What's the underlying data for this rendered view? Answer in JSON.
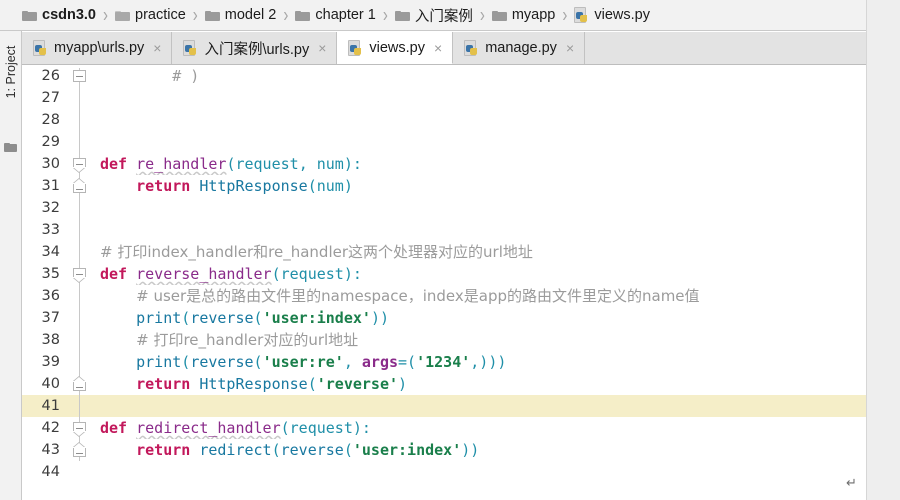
{
  "window": {
    "right_strip_color": "#eeeeee"
  },
  "breadcrumb": {
    "name": "project-breadcrumb",
    "separator": "›",
    "items": [
      {
        "label": "csdn3.0",
        "icon": "folder-icon",
        "bold": true
      },
      {
        "label": "practice",
        "icon": "folder-open-icon",
        "bold": false
      },
      {
        "label": "model 2",
        "icon": "folder-icon",
        "bold": false
      },
      {
        "label": "chapter 1",
        "icon": "folder-icon",
        "bold": false
      },
      {
        "label": "入门案例",
        "icon": "folder-icon",
        "bold": false
      },
      {
        "label": "myapp",
        "icon": "folder-icon",
        "bold": false
      },
      {
        "label": "views.py",
        "icon": "python-file-icon",
        "bold": false
      }
    ]
  },
  "tool_window": {
    "label": "1: Project",
    "icon": "folder-icon"
  },
  "tabs": [
    {
      "label": "myapp\\urls.py",
      "icon": "python-file-icon",
      "close": "×",
      "active": false
    },
    {
      "label": "入门案例\\urls.py",
      "icon": "python-file-icon",
      "close": "×",
      "active": false
    },
    {
      "label": "views.py",
      "icon": "python-file-icon",
      "close": "×",
      "active": true
    },
    {
      "label": "manage.py",
      "icon": "python-file-icon",
      "close": "×",
      "active": false
    }
  ],
  "editor": {
    "current_line": 41,
    "current_line_color": "#f5eec8",
    "end_of_file_glyph": "↵",
    "first_line": 26,
    "last_line": 44,
    "lines": [
      {
        "num": "26",
        "fold": "collapsed-box",
        "text": "        # )"
      },
      {
        "num": "27",
        "fold": "line",
        "text": ""
      },
      {
        "num": "28",
        "fold": "line",
        "text": ""
      },
      {
        "num": "29",
        "fold": "line",
        "text": ""
      },
      {
        "num": "30",
        "fold": "block-start",
        "text": "def re_handler(request, num):"
      },
      {
        "num": "31",
        "fold": "block-end",
        "text": "    return HttpResponse(num)"
      },
      {
        "num": "32",
        "fold": "line",
        "text": ""
      },
      {
        "num": "33",
        "fold": "line",
        "text": ""
      },
      {
        "num": "34",
        "fold": "line",
        "text": "# 打印index_handler和re_handler这两个处理器对应的url地址"
      },
      {
        "num": "35",
        "fold": "block-start",
        "text": "def reverse_handler(request):"
      },
      {
        "num": "36",
        "fold": "line",
        "text": "    # user是总的路由文件里的namespace，index是app的路由文件里定义的name值"
      },
      {
        "num": "37",
        "fold": "line",
        "text": "    print(reverse('user:index'))"
      },
      {
        "num": "38",
        "fold": "line",
        "text": "    # 打印re_handler对应的url地址"
      },
      {
        "num": "39",
        "fold": "line",
        "text": "    print(reverse('user:re', args=('1234',)))"
      },
      {
        "num": "40",
        "fold": "block-end",
        "text": "    return HttpResponse('reverse')"
      },
      {
        "num": "41",
        "fold": "line",
        "text": ""
      },
      {
        "num": "42",
        "fold": "block-start",
        "text": "def redirect_handler(request):"
      },
      {
        "num": "43",
        "fold": "block-end",
        "text": "    return redirect(reverse('user:index'))"
      },
      {
        "num": "44",
        "fold": "none",
        "text": ""
      }
    ]
  },
  "syntax_colors": {
    "keyword": "#c2185b",
    "function_name": "#8a2b8a",
    "call": "#1878a0",
    "parameter": "#1f8fa8",
    "string": "#1a7f4b",
    "comment": "#9b9b9b",
    "named_arg": "#8a2b8a",
    "punctuation": "#1f8fa8"
  }
}
